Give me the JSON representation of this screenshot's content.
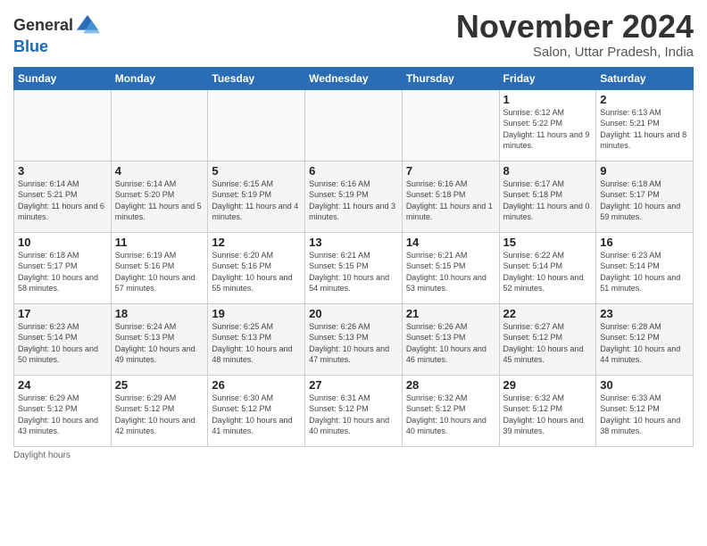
{
  "logo": {
    "general": "General",
    "blue": "Blue"
  },
  "header": {
    "month": "November 2024",
    "location": "Salon, Uttar Pradesh, India"
  },
  "days_of_week": [
    "Sunday",
    "Monday",
    "Tuesday",
    "Wednesday",
    "Thursday",
    "Friday",
    "Saturday"
  ],
  "weeks": [
    [
      {
        "day": "",
        "info": "",
        "empty": true
      },
      {
        "day": "",
        "info": "",
        "empty": true
      },
      {
        "day": "",
        "info": "",
        "empty": true
      },
      {
        "day": "",
        "info": "",
        "empty": true
      },
      {
        "day": "",
        "info": "",
        "empty": true
      },
      {
        "day": "1",
        "info": "Sunrise: 6:12 AM\nSunset: 5:22 PM\nDaylight: 11 hours and 9 minutes."
      },
      {
        "day": "2",
        "info": "Sunrise: 6:13 AM\nSunset: 5:21 PM\nDaylight: 11 hours and 8 minutes."
      }
    ],
    [
      {
        "day": "3",
        "info": "Sunrise: 6:14 AM\nSunset: 5:21 PM\nDaylight: 11 hours and 6 minutes."
      },
      {
        "day": "4",
        "info": "Sunrise: 6:14 AM\nSunset: 5:20 PM\nDaylight: 11 hours and 5 minutes."
      },
      {
        "day": "5",
        "info": "Sunrise: 6:15 AM\nSunset: 5:19 PM\nDaylight: 11 hours and 4 minutes."
      },
      {
        "day": "6",
        "info": "Sunrise: 6:16 AM\nSunset: 5:19 PM\nDaylight: 11 hours and 3 minutes."
      },
      {
        "day": "7",
        "info": "Sunrise: 6:16 AM\nSunset: 5:18 PM\nDaylight: 11 hours and 1 minute."
      },
      {
        "day": "8",
        "info": "Sunrise: 6:17 AM\nSunset: 5:18 PM\nDaylight: 11 hours and 0 minutes."
      },
      {
        "day": "9",
        "info": "Sunrise: 6:18 AM\nSunset: 5:17 PM\nDaylight: 10 hours and 59 minutes."
      }
    ],
    [
      {
        "day": "10",
        "info": "Sunrise: 6:18 AM\nSunset: 5:17 PM\nDaylight: 10 hours and 58 minutes."
      },
      {
        "day": "11",
        "info": "Sunrise: 6:19 AM\nSunset: 5:16 PM\nDaylight: 10 hours and 57 minutes."
      },
      {
        "day": "12",
        "info": "Sunrise: 6:20 AM\nSunset: 5:16 PM\nDaylight: 10 hours and 55 minutes."
      },
      {
        "day": "13",
        "info": "Sunrise: 6:21 AM\nSunset: 5:15 PM\nDaylight: 10 hours and 54 minutes."
      },
      {
        "day": "14",
        "info": "Sunrise: 6:21 AM\nSunset: 5:15 PM\nDaylight: 10 hours and 53 minutes."
      },
      {
        "day": "15",
        "info": "Sunrise: 6:22 AM\nSunset: 5:14 PM\nDaylight: 10 hours and 52 minutes."
      },
      {
        "day": "16",
        "info": "Sunrise: 6:23 AM\nSunset: 5:14 PM\nDaylight: 10 hours and 51 minutes."
      }
    ],
    [
      {
        "day": "17",
        "info": "Sunrise: 6:23 AM\nSunset: 5:14 PM\nDaylight: 10 hours and 50 minutes."
      },
      {
        "day": "18",
        "info": "Sunrise: 6:24 AM\nSunset: 5:13 PM\nDaylight: 10 hours and 49 minutes."
      },
      {
        "day": "19",
        "info": "Sunrise: 6:25 AM\nSunset: 5:13 PM\nDaylight: 10 hours and 48 minutes."
      },
      {
        "day": "20",
        "info": "Sunrise: 6:26 AM\nSunset: 5:13 PM\nDaylight: 10 hours and 47 minutes."
      },
      {
        "day": "21",
        "info": "Sunrise: 6:26 AM\nSunset: 5:13 PM\nDaylight: 10 hours and 46 minutes."
      },
      {
        "day": "22",
        "info": "Sunrise: 6:27 AM\nSunset: 5:12 PM\nDaylight: 10 hours and 45 minutes."
      },
      {
        "day": "23",
        "info": "Sunrise: 6:28 AM\nSunset: 5:12 PM\nDaylight: 10 hours and 44 minutes."
      }
    ],
    [
      {
        "day": "24",
        "info": "Sunrise: 6:29 AM\nSunset: 5:12 PM\nDaylight: 10 hours and 43 minutes."
      },
      {
        "day": "25",
        "info": "Sunrise: 6:29 AM\nSunset: 5:12 PM\nDaylight: 10 hours and 42 minutes."
      },
      {
        "day": "26",
        "info": "Sunrise: 6:30 AM\nSunset: 5:12 PM\nDaylight: 10 hours and 41 minutes."
      },
      {
        "day": "27",
        "info": "Sunrise: 6:31 AM\nSunset: 5:12 PM\nDaylight: 10 hours and 40 minutes."
      },
      {
        "day": "28",
        "info": "Sunrise: 6:32 AM\nSunset: 5:12 PM\nDaylight: 10 hours and 40 minutes."
      },
      {
        "day": "29",
        "info": "Sunrise: 6:32 AM\nSunset: 5:12 PM\nDaylight: 10 hours and 39 minutes."
      },
      {
        "day": "30",
        "info": "Sunrise: 6:33 AM\nSunset: 5:12 PM\nDaylight: 10 hours and 38 minutes."
      }
    ]
  ],
  "footer": {
    "daylight_label": "Daylight hours"
  }
}
